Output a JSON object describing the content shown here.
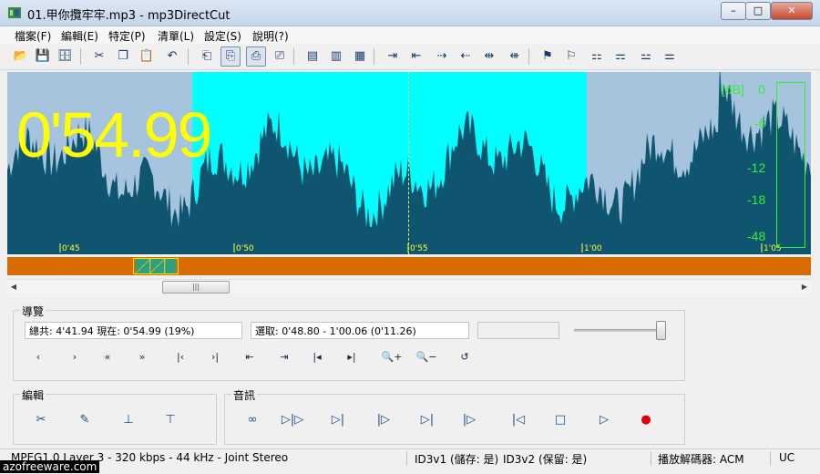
{
  "window": {
    "title": "01.甲你攬牢牢.mp3 - mp3DirectCut",
    "minimize": "–",
    "maximize": "□",
    "close": "✕"
  },
  "menu": [
    "檔案(F)",
    "編輯(E)",
    "特定(P)",
    "清單(L)",
    "設定(S)",
    "說明(?)"
  ],
  "toolbar": {
    "icons": [
      "open-icon",
      "save-icon",
      "save-all-icon",
      "cut-icon",
      "copy-icon",
      "paste-icon",
      "undo-icon",
      "insert-icon",
      "mark-icon",
      "fade-icon",
      "volume-icon",
      "play-all-icon",
      "play-sel-icon",
      "play-end-icon",
      "cue-start-icon",
      "cue-end-icon",
      "sel-start-icon",
      "sel-end-icon",
      "cut-start-icon",
      "cut-end-icon",
      "split-icon",
      "split-sel-icon",
      "split-all-icon",
      "split-pause-icon",
      "split-auto-icon",
      "split-list-icon"
    ],
    "glyphs": [
      "📂",
      "💾",
      "🗄",
      "✂",
      "❐",
      "📋",
      "↶",
      "⎗",
      "⎘",
      "⎙",
      "⎚",
      "▤",
      "▥",
      "▦",
      "⇥",
      "⇤",
      "⇢",
      "⇠",
      "⇹",
      "⇺",
      "⚑",
      "⚐",
      "⚏",
      "⚎",
      "⚍",
      "⚌"
    ]
  },
  "waveform": {
    "time_display": "0'54.99",
    "ruler": [
      "0'45",
      "0'50",
      "0'55",
      "1'00",
      "1'05"
    ],
    "db_unit": "[dB]",
    "db_scale": [
      "0",
      "-6",
      "-12",
      "-18",
      "-48"
    ],
    "colors": {
      "background": "#a6c4dd",
      "selection": "#00ffff",
      "wave": "#0f5570",
      "display": "#ffff00",
      "meter": "#33ee33"
    }
  },
  "navigation": {
    "label": "導覽",
    "total": "總共: 4'41.94  現在: 0'54.99  (19%)",
    "selection": "選取: 0'48.80 - 1'00.06 (0'11.26)",
    "volume_level_pct": 100,
    "buttons": [
      {
        "name": "prev-frame-icon",
        "glyph": "‹"
      },
      {
        "name": "next-frame-icon",
        "glyph": "›"
      },
      {
        "name": "rewind-icon",
        "glyph": "«"
      },
      {
        "name": "fast-forward-icon",
        "glyph": "»"
      },
      {
        "name": "goto-begin-icon",
        "glyph": "|‹"
      },
      {
        "name": "goto-end-icon",
        "glyph": "›|"
      },
      {
        "name": "sel-begin-icon",
        "glyph": "⇤"
      },
      {
        "name": "sel-end-icon",
        "glyph": "⇥"
      },
      {
        "name": "prev-cue-icon",
        "glyph": "|◂"
      },
      {
        "name": "next-cue-icon",
        "glyph": "▸|"
      },
      {
        "name": "zoom-in-icon",
        "glyph": "🔍+"
      },
      {
        "name": "zoom-out-icon",
        "glyph": "🔍−"
      },
      {
        "name": "view-reset-icon",
        "glyph": "↺"
      }
    ]
  },
  "edit": {
    "label": "編輯",
    "buttons": [
      "cut-sel-icon",
      "fade-sel-icon",
      "split-here-icon",
      "split-mark-icon"
    ],
    "glyphs": [
      "✂",
      "✎",
      "⊥",
      "⊤"
    ]
  },
  "audio": {
    "label": "音訊",
    "buttons": [
      {
        "name": "loop-play-icon",
        "glyph": "∞"
      },
      {
        "name": "play-selection-icon",
        "glyph": "▷|▷"
      },
      {
        "name": "play-to-cursor-icon",
        "glyph": "▷|"
      },
      {
        "name": "play-from-cursor-icon",
        "glyph": "|▷"
      },
      {
        "name": "play-before-icon",
        "glyph": "▷|"
      },
      {
        "name": "play-after-icon",
        "glyph": "|▷"
      },
      {
        "name": "skip-back-icon",
        "glyph": "|◁"
      },
      {
        "name": "stop-icon",
        "glyph": "□"
      },
      {
        "name": "play-icon",
        "glyph": "▷"
      },
      {
        "name": "record-icon",
        "glyph": "●"
      }
    ]
  },
  "status": {
    "format": "MPEG1.0 Layer 3 - 320 kbps - 44 kHz - Joint Stereo",
    "id3v1": "ID3v1 (儲存: 是)",
    "id3v2": "ID3v2 (保留: 是)",
    "decoder": "播放解碼器: ACM",
    "uc": "UC"
  },
  "watermark": "azofreeware.com"
}
